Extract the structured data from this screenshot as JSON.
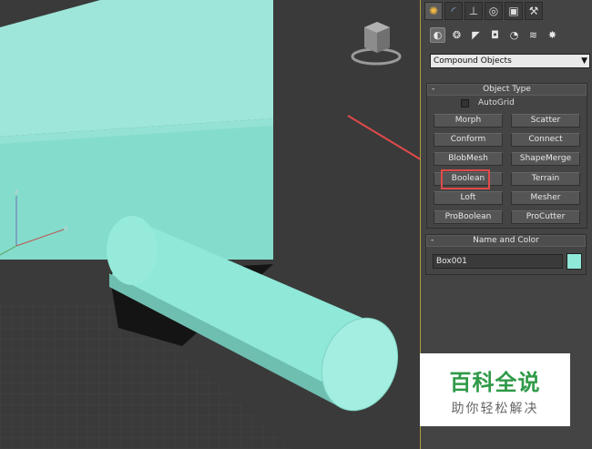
{
  "viewport": {
    "axis_z": "z",
    "axis_x": "x",
    "colors": {
      "object": "#8fe8d8",
      "background": "#3a3a3a",
      "arrow": "#e04a4a"
    }
  },
  "panel": {
    "tabs": [
      {
        "icon": "sun-icon"
      },
      {
        "icon": "curve-icon"
      },
      {
        "icon": "hierarchy-icon"
      },
      {
        "icon": "motion-icon"
      },
      {
        "icon": "display-icon"
      },
      {
        "icon": "hammer-icon"
      }
    ],
    "subtabs": [
      {
        "icon": "geometry-sphere-icon"
      },
      {
        "icon": "shapes-icon"
      },
      {
        "icon": "light-icon"
      },
      {
        "icon": "camera-icon"
      },
      {
        "icon": "helper-icon"
      },
      {
        "icon": "spacewarp-icon"
      },
      {
        "icon": "systems-icon"
      }
    ],
    "category_dropdown": "Compound Objects",
    "object_type": {
      "title": "Object Type",
      "collapse_symbol": "-",
      "autogrid_label": "AutoGrid",
      "buttons": [
        "Morph",
        "Scatter",
        "Conform",
        "Connect",
        "BlobMesh",
        "ShapeMerge",
        "Boolean",
        "Terrain",
        "Loft",
        "Mesher",
        "ProBoolean",
        "ProCutter"
      ]
    },
    "name_color": {
      "title": "Name and Color",
      "collapse_symbol": "-",
      "name_value": "Box001",
      "color": "#8fe8d8"
    }
  },
  "watermark": {
    "title": "百科全说",
    "subtitle": "助你轻松解决"
  }
}
